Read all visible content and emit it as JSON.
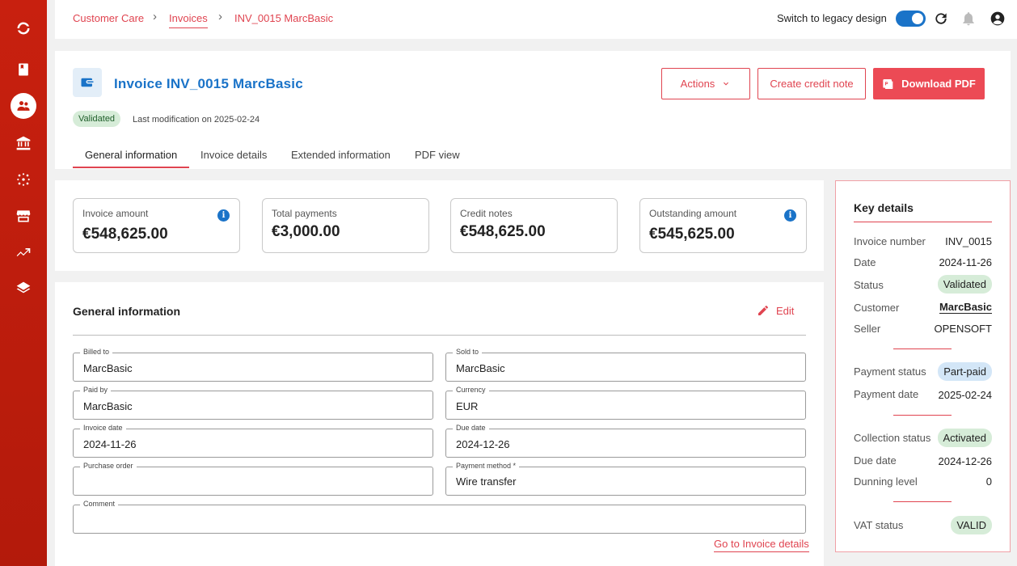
{
  "breadcrumb": {
    "items": [
      "Customer Care",
      "Invoices",
      "INV_0015 MarcBasic"
    ]
  },
  "topbar": {
    "legacy_label": "Switch to legacy design",
    "legacy_toggle_on": true
  },
  "sidebar": {
    "items": [
      "logo-icon",
      "book-icon",
      "customers-icon",
      "bank-icon",
      "network-icon",
      "store-icon",
      "trend-icon",
      "layers-icon"
    ],
    "active_index": 2
  },
  "header": {
    "title": "Invoice INV_0015 MarcBasic",
    "status": "Validated",
    "last_modification": "Last modification on 2025-02-24",
    "actions_label": "Actions",
    "credit_note_label": "Create credit note",
    "download_label": "Download PDF",
    "tabs": [
      "General information",
      "Invoice details",
      "Extended information",
      "PDF view"
    ],
    "active_tab": 0
  },
  "summary": [
    {
      "label": "Invoice amount",
      "value": "€548,625.00",
      "info": true
    },
    {
      "label": "Total payments",
      "value": "€3,000.00",
      "info": false
    },
    {
      "label": "Credit notes",
      "value": "€548,625.00",
      "info": false
    },
    {
      "label": "Outstanding amount",
      "value": "€545,625.00",
      "info": true
    }
  ],
  "general": {
    "title": "General information",
    "edit_label": "Edit",
    "fields": {
      "billed_to": {
        "label": "Billed to",
        "value": "MarcBasic"
      },
      "sold_to": {
        "label": "Sold to",
        "value": "MarcBasic"
      },
      "paid_by": {
        "label": "Paid by",
        "value": "MarcBasic"
      },
      "currency": {
        "label": "Currency",
        "value": "EUR"
      },
      "invoice_date": {
        "label": "Invoice date",
        "value": "2024-11-26"
      },
      "due_date": {
        "label": "Due date",
        "value": "2024-12-26"
      },
      "purchase_order": {
        "label": "Purchase order",
        "value": ""
      },
      "payment_method": {
        "label": "Payment method *",
        "value": "Wire transfer"
      },
      "comment": {
        "label": "Comment",
        "value": ""
      }
    },
    "goto_link": "Go to Invoice details"
  },
  "key_details": {
    "title": "Key details",
    "invoice_number": {
      "label": "Invoice number",
      "value": "INV_0015"
    },
    "date": {
      "label": "Date",
      "value": "2024-11-26"
    },
    "status": {
      "label": "Status",
      "value": "Validated"
    },
    "customer": {
      "label": "Customer",
      "value": "MarcBasic"
    },
    "seller": {
      "label": "Seller",
      "value": "OPENSOFT"
    },
    "payment_status": {
      "label": "Payment status",
      "value": "Part-paid"
    },
    "payment_date": {
      "label": "Payment date",
      "value": "2025-02-24"
    },
    "collection_status": {
      "label": "Collection status",
      "value": "Activated"
    },
    "due_date": {
      "label": "Due date",
      "value": "2024-12-26"
    },
    "dunning_level": {
      "label": "Dunning level",
      "value": "0"
    },
    "vat_status": {
      "label": "VAT status",
      "value": "VALID"
    }
  },
  "colors": {
    "brand_red": "#c8200f",
    "accent_red": "#e04450",
    "primary_blue": "#1a73c8"
  }
}
